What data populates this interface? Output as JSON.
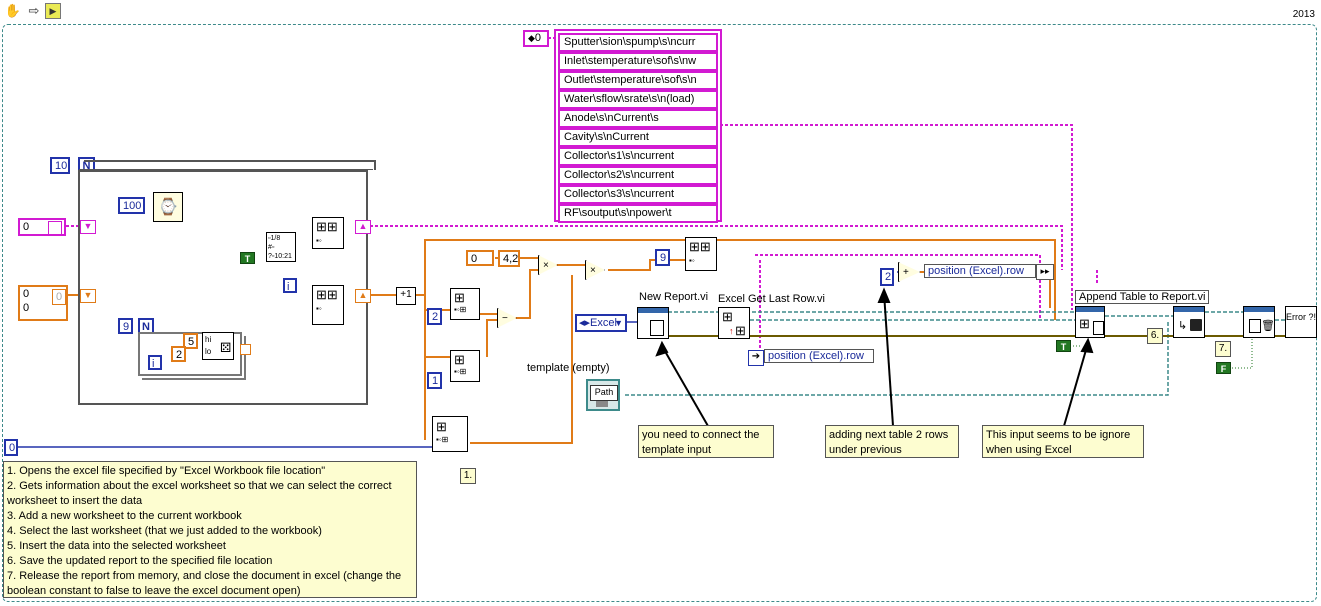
{
  "version_year": "2013",
  "array_index": "0",
  "header_labels": [
    "Sputter\\sion\\spump\\s\\ncurr",
    "Inlet\\stemperature\\sof\\s\\nw",
    "Outlet\\stemperature\\sof\\s\\n",
    "Water\\sflow\\srate\\s\\n(load)",
    "Anode\\s\\nCurrent\\s",
    "Cavity\\s\\nCurrent",
    "Collector\\s1\\s\\ncurrent",
    "Collector\\s2\\s\\ncurrent",
    "Collector\\s3\\s\\ncurrent",
    "RF\\soutput\\s\\npower\\t"
  ],
  "for_loop": {
    "count": "10",
    "count_symbol": "N",
    "wait_ms": "100",
    "iteration_symbol": "i"
  },
  "inner_loop": {
    "count": "9",
    "count_symbol": "N",
    "iteration_symbol": "i",
    "random_hi": "5",
    "random_lo": "2",
    "hi_label": "hi",
    "lo_label": "lo"
  },
  "left_constants": {
    "pink_index": "0",
    "orange_a": "0",
    "orange_b": "0",
    "orange_elem": "0"
  },
  "shift_consts": {
    "a": "0",
    "b": "4,2",
    "c": "2",
    "d": "1",
    "e": "9",
    "f": "0",
    "g": "2"
  },
  "bool_true": "T",
  "bool_false": "F",
  "report_type": "Excel",
  "template_label": "template (empty)",
  "path_label": "Path",
  "labels": {
    "new_report": "New Report.vi",
    "get_last_row": "Excel Get Last Row.vi",
    "append_table": "Append Table to Report.vi",
    "position_row_1": "position (Excel).row",
    "position_row_2": "position (Excel).row"
  },
  "notes": {
    "template": "you need to connect the template input",
    "adding": "adding next table 2 rows under previous",
    "ignored": "This input seems to be ignore when using Excel"
  },
  "steps": {
    "s1": "1.",
    "s6": "6.",
    "s7": "7."
  },
  "instructions": [
    "1. Opens the excel file specified by \"Excel Workbook file location\"",
    "2. Gets information about the excel worksheet so that we can select the correct worksheet to insert the data",
    "3. Add a new worksheet to the current workbook",
    "4. Select the last worksheet (that we just added to the workbook)",
    "5. Insert the data into the selected worksheet",
    "6. Save the updated report to the specified file location",
    "7. Release the report from memory, and close the document in excel (change the boolean constant to false to leave the excel document open)"
  ],
  "error_label": "Error ?!",
  "colors": {
    "pink_wire": "#d21ad2",
    "orange_wire": "#e07b18",
    "blue_wire": "#2233aa",
    "teal_wire": "#3d8a8a",
    "green_wire": "#227722"
  }
}
